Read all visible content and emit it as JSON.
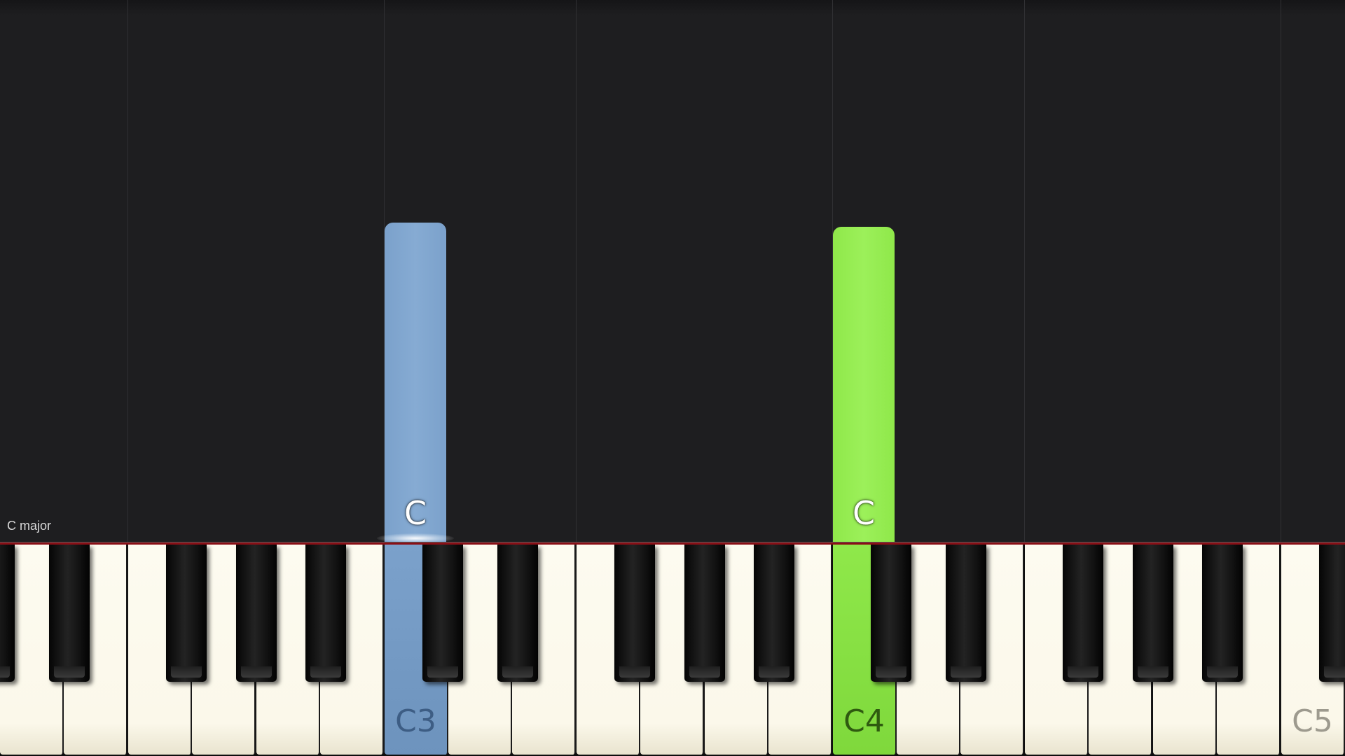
{
  "piano_roll": {
    "key_name": "C major",
    "notes": [
      {
        "label": "C",
        "color": "#7ba1cb",
        "white_index": 6
      },
      {
        "label": "C",
        "color": "#8fe84a",
        "white_index": 13
      }
    ]
  },
  "keyboard": {
    "white_key_count": 21,
    "black_key_offset_count": 21,
    "octave_labels": [
      {
        "label": "C3",
        "white_index": 6,
        "color": "#3d5d84"
      },
      {
        "label": "C4",
        "white_index": 13,
        "color": "#2f5a10"
      },
      {
        "label": "C5",
        "white_index": 20,
        "color": "#9d9a8e"
      }
    ]
  }
}
